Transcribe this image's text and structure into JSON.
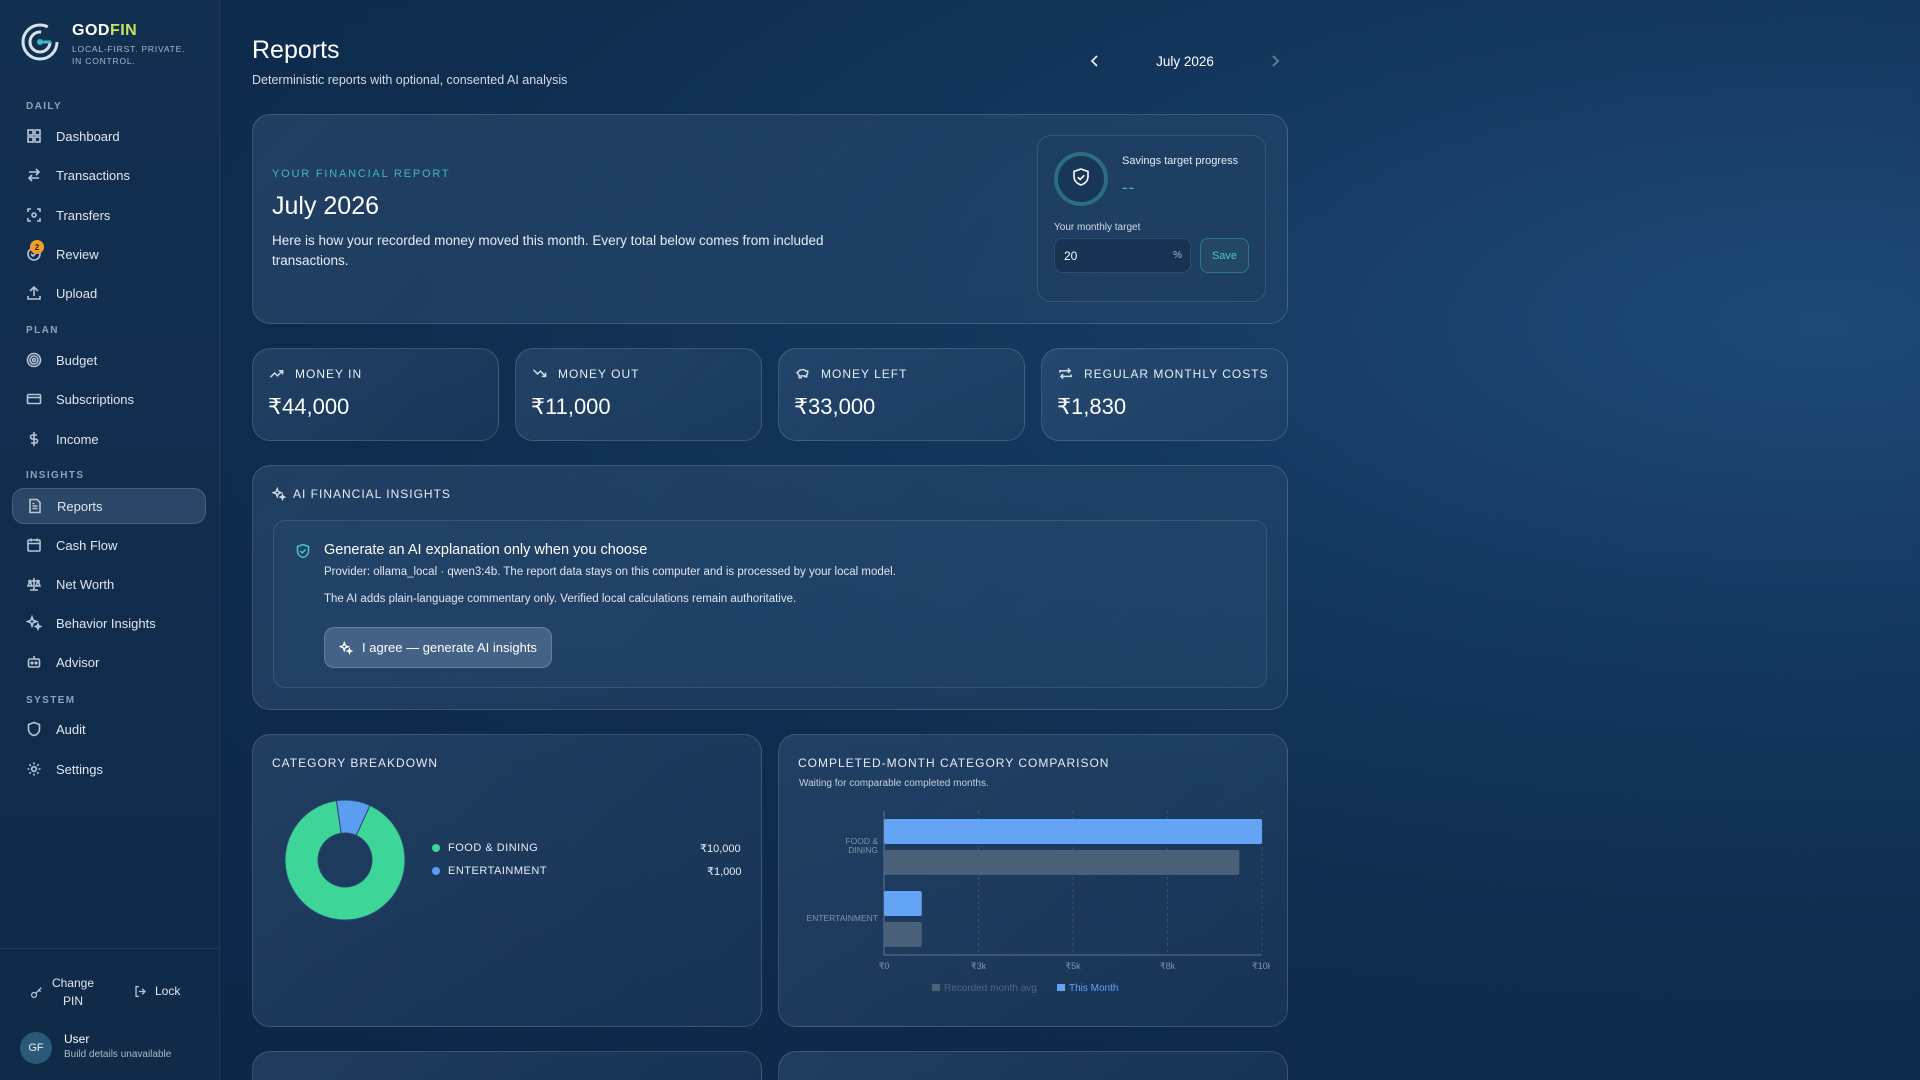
{
  "brand": {
    "name_a": "GOD",
    "name_b": "FIN",
    "tagline": "LOCAL-FIRST. PRIVATE. IN CONTROL."
  },
  "nav": {
    "sections": [
      "DAILY",
      "PLAN",
      "INSIGHTS",
      "SYSTEM"
    ],
    "items": [
      {
        "label": "Dashboard",
        "icon": "grid-icon"
      },
      {
        "label": "Transactions",
        "icon": "arrows-icon"
      },
      {
        "label": "Transfers",
        "icon": "transfer-icon"
      },
      {
        "label": "Review",
        "icon": "review-icon",
        "badge": "2"
      },
      {
        "label": "Upload",
        "icon": "upload-icon"
      },
      {
        "label": "Budget",
        "icon": "target-icon"
      },
      {
        "label": "Subscriptions",
        "icon": "card-icon"
      },
      {
        "label": "Income",
        "icon": "dollar-icon"
      },
      {
        "label": "Reports",
        "icon": "document-icon",
        "active": true
      },
      {
        "label": "Cash Flow",
        "icon": "calendar-icon"
      },
      {
        "label": "Net Worth",
        "icon": "scale-icon"
      },
      {
        "label": "Behavior Insights",
        "icon": "sparkle-icon"
      },
      {
        "label": "Advisor",
        "icon": "robot-icon"
      },
      {
        "label": "Audit",
        "icon": "shield-icon"
      },
      {
        "label": "Settings",
        "icon": "gear-icon"
      }
    ],
    "change_pin": "Change PIN",
    "lock": "Lock"
  },
  "user": {
    "initials": "GF",
    "name": "User",
    "build": "Build details unavailable"
  },
  "header": {
    "title": "Reports",
    "subtitle": "Deterministic reports with optional, consented AI analysis",
    "month": "July 2026"
  },
  "hero": {
    "eyebrow": "YOUR FINANCIAL REPORT",
    "title": "July 2026",
    "description": "Here is how your recorded money moved this month. Every total below comes from included transactions.",
    "savings_label": "Savings target progress",
    "savings_value": "--",
    "monthly_target_label": "Your monthly target",
    "monthly_target_value": "20",
    "percent_suffix": "%",
    "save_label": "Save"
  },
  "stats": [
    {
      "label": "MONEY IN",
      "value": "₹44,000",
      "icon": "trend-up-icon"
    },
    {
      "label": "MONEY OUT",
      "value": "₹11,000",
      "icon": "trend-down-icon"
    },
    {
      "label": "MONEY LEFT",
      "value": "₹33,000",
      "icon": "piggy-icon"
    },
    {
      "label": "REGULAR MONTHLY COSTS",
      "value": "₹1,830",
      "icon": "repeat-icon"
    }
  ],
  "ai": {
    "heading": "AI FINANCIAL INSIGHTS",
    "title": "Generate an AI explanation only when you choose",
    "provider_line": "Provider: ollama_local · qwen3:4b. The report data stays on this computer and is processed by your local model.",
    "note_line": "The AI adds plain-language commentary only. Verified local calculations remain authoritative.",
    "button_label": "I agree — generate AI insights"
  },
  "colors": {
    "accent": "#3fb6c9",
    "food": "#3ed598",
    "entertainment": "#5b9df0",
    "bar_this": "#63a4f5",
    "bar_avg": "#4a5f78"
  },
  "chart_data": [
    {
      "type": "pie",
      "title": "CATEGORY BREAKDOWN",
      "categories": [
        "FOOD & DINING",
        "ENTERTAINMENT"
      ],
      "values": [
        10000,
        1000
      ],
      "value_labels": [
        "₹10,000",
        "₹1,000"
      ]
    },
    {
      "type": "bar",
      "orientation": "horizontal",
      "title": "COMPLETED-MONTH CATEGORY COMPARISON",
      "subtitle": "Waiting for comparable completed months.",
      "categories": [
        "FOOD & DINING",
        "ENTERTAINMENT"
      ],
      "series": [
        {
          "name": "This Month",
          "values": [
            10000,
            1000
          ]
        },
        {
          "name": "Recorded month avg",
          "values": [
            9400,
            1000
          ]
        }
      ],
      "xlim": [
        0,
        10000
      ],
      "x_ticks": [
        "₹0",
        "₹3k",
        "₹5k",
        "₹8k",
        "₹10k"
      ],
      "legend": "bottom"
    }
  ]
}
